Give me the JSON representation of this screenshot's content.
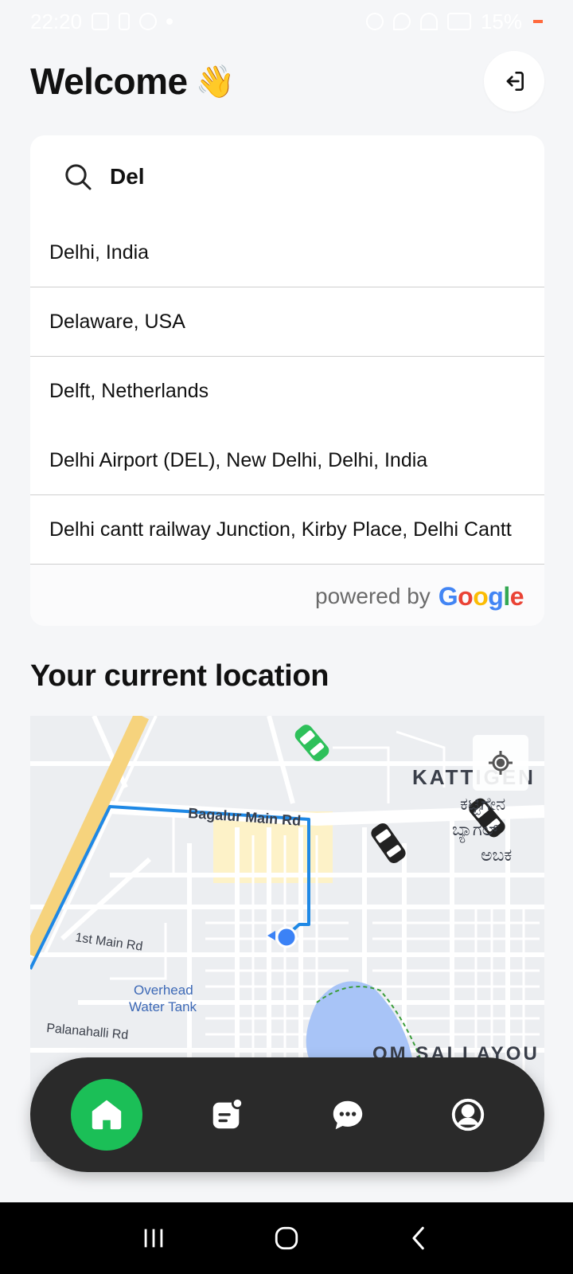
{
  "status_bar": {
    "time": "22:20",
    "battery": "15%"
  },
  "header": {
    "title": "Welcome",
    "emoji": "👋"
  },
  "search": {
    "value": "Del",
    "suggestions": [
      "Delhi, India",
      "Delaware, USA",
      "Delft, Netherlands",
      "Delhi Airport (DEL), New Delhi, Delhi, India",
      "Delhi cantt railway Junction, Kirby Place, Delhi Cantt"
    ],
    "powered_by": "powered by"
  },
  "current_location": {
    "title": "Your current location",
    "map_labels": {
      "road_main": "Bagalur Main Rd",
      "road_1st": "1st Main Rd",
      "road_palanahalli": "Palanahalli Rd",
      "poi_tank_1": "Overhead",
      "poi_tank_2": "Water Tank",
      "area_kattigen": "KATTIGEN",
      "area_kannada_1": "ಕಟ್ಟಿಗೇನ",
      "area_kannada_2": "ಬ್ಯಾಗಲ್",
      "area_kannada_3": "ಅಬಕ",
      "area_om": "OM SAI LAYOU"
    }
  },
  "bottom_nav": {
    "items": [
      "home-icon",
      "orders-icon",
      "chat-icon",
      "profile-icon"
    ],
    "active": "home"
  },
  "colors": {
    "accent": "#1bbf57",
    "nav_bg": "#2a2a2a",
    "route": "#1e88e5"
  }
}
